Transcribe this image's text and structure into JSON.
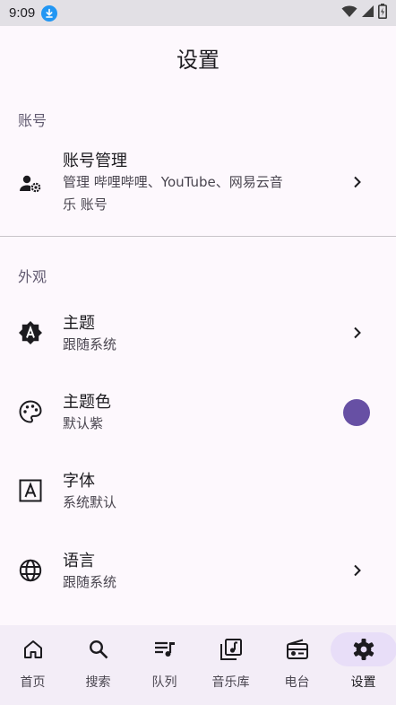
{
  "status_bar": {
    "time": "9:09"
  },
  "page_title": "设置",
  "sections": {
    "account": {
      "header": "账号",
      "items": [
        {
          "title": "账号管理",
          "subtitle_line1": "管理 哔哩哔哩、YouTube、网易云音",
          "subtitle_line2": "乐 账号",
          "icon": "manage-accounts-icon"
        }
      ]
    },
    "appearance": {
      "header": "外观",
      "items": [
        {
          "title": "主题",
          "subtitle": "跟随系统",
          "icon": "brightness-auto-icon"
        },
        {
          "title": "主题色",
          "subtitle": "默认紫",
          "icon": "palette-icon",
          "accent_color": "#6750a4"
        },
        {
          "title": "字体",
          "subtitle": "系统默认",
          "icon": "font-icon"
        },
        {
          "title": "语言",
          "subtitle": "跟随系统",
          "icon": "globe-icon"
        }
      ]
    }
  },
  "bottom_nav": {
    "items": [
      {
        "label": "首页",
        "icon": "home-icon"
      },
      {
        "label": "搜索",
        "icon": "search-icon"
      },
      {
        "label": "队列",
        "icon": "queue-music-icon"
      },
      {
        "label": "音乐库",
        "icon": "library-music-icon"
      },
      {
        "label": "电台",
        "icon": "radio-icon"
      },
      {
        "label": "设置",
        "icon": "settings-icon",
        "active": true
      }
    ]
  }
}
